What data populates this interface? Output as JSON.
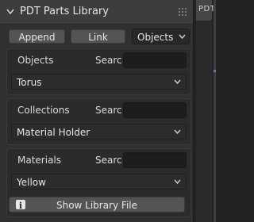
{
  "panel": {
    "title": "PDT Parts Library"
  },
  "toolbar": {
    "append_label": "Append",
    "link_label": "Link",
    "mode_value": "Objects"
  },
  "sections": [
    {
      "label": "Objects",
      "search_label": "Searc",
      "search_value": "",
      "selected": "Torus"
    },
    {
      "label": "Collections",
      "search_label": "Searc",
      "search_value": "",
      "selected": "Material Holder"
    },
    {
      "label": "Materials",
      "search_label": "Searc",
      "search_value": "",
      "selected": "Yellow"
    }
  ],
  "footer": {
    "show_library_label": "Show Library File"
  },
  "sidebar_tab": {
    "label": "PDT"
  },
  "icons": {
    "header": "chevron-down-icon",
    "grip": "drag-grip-icon",
    "info": "info-icon"
  }
}
